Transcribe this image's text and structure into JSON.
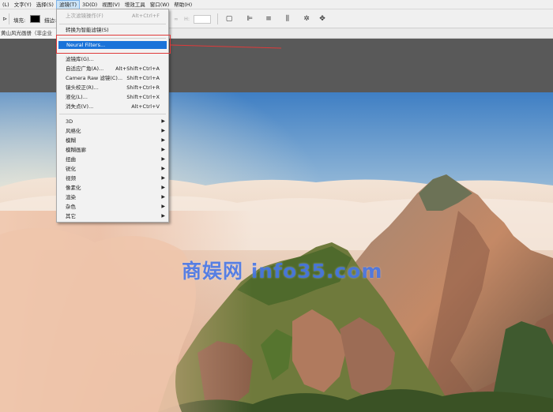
{
  "menubar": {
    "items": [
      {
        "label": "(L)"
      },
      {
        "label": "文字(Y)"
      },
      {
        "label": "选择(S)"
      },
      {
        "label": "滤镜(T)",
        "active": true
      },
      {
        "label": "3D(D)"
      },
      {
        "label": "视图(V)"
      },
      {
        "label": "增效工具"
      },
      {
        "label": "窗口(W)"
      },
      {
        "label": "帮助(H)"
      }
    ]
  },
  "options": {
    "fill_label": "填充:",
    "stroke_label": "描边:",
    "h_label": "H:",
    "fill_color": "#000000"
  },
  "document_tab": {
    "title": "黄山风光画册（非企业"
  },
  "filter_menu": {
    "items": [
      {
        "label": "上次滤镜操作(F)",
        "shortcut": "Alt+Ctrl+F",
        "disabled": true
      },
      {
        "label": "转换为智能滤镜(S)",
        "shortcut": ""
      },
      {
        "label": "Neural Filters...",
        "shortcut": "",
        "highlighted": true
      },
      {
        "label": "滤镜库(G)...",
        "shortcut": ""
      },
      {
        "label": "自适应广角(A)...",
        "shortcut": "Alt+Shift+Ctrl+A"
      },
      {
        "label": "Camera Raw 滤镜(C)...",
        "shortcut": "Shift+Ctrl+A"
      },
      {
        "label": "镜头校正(R)...",
        "shortcut": "Shift+Ctrl+R"
      },
      {
        "label": "液化(L)...",
        "shortcut": "Shift+Ctrl+X"
      },
      {
        "label": "消失点(V)...",
        "shortcut": "Alt+Ctrl+V"
      },
      {
        "label": "3D",
        "submenu": true
      },
      {
        "label": "风格化",
        "submenu": true
      },
      {
        "label": "模糊",
        "submenu": true
      },
      {
        "label": "模糊画廊",
        "submenu": true
      },
      {
        "label": "扭曲",
        "submenu": true
      },
      {
        "label": "锐化",
        "submenu": true
      },
      {
        "label": "视频",
        "submenu": true
      },
      {
        "label": "像素化",
        "submenu": true
      },
      {
        "label": "渲染",
        "submenu": true
      },
      {
        "label": "杂色",
        "submenu": true
      },
      {
        "label": "其它",
        "submenu": true
      }
    ]
  },
  "watermark": {
    "text": "商娱网 info35.com"
  },
  "colors": {
    "highlight": "#1a73d9",
    "annotation_red": "#e03a3a",
    "watermark_blue": "#3c6ee6"
  }
}
